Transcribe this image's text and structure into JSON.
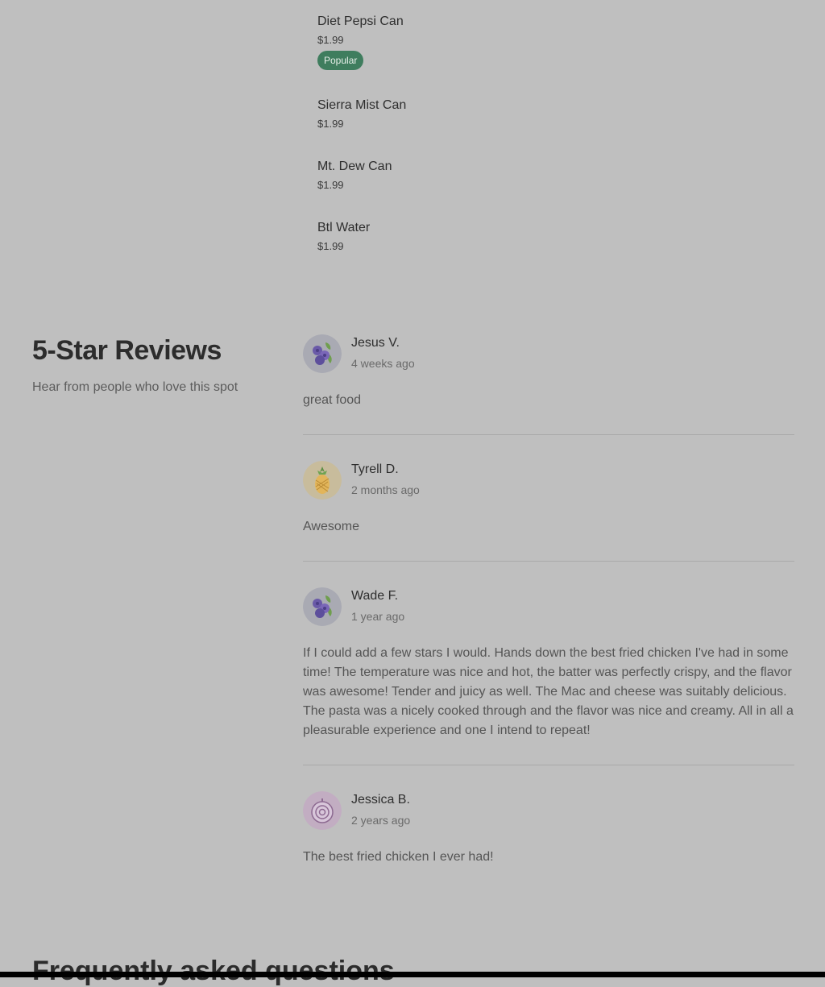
{
  "menu": {
    "items": [
      {
        "name": "Diet Pepsi Can",
        "price": "$1.99",
        "badge": "Popular"
      },
      {
        "name": "Sierra Mist Can",
        "price": "$1.99"
      },
      {
        "name": "Mt. Dew Can",
        "price": "$1.99"
      },
      {
        "name": "Btl Water",
        "price": "$1.99"
      }
    ]
  },
  "reviews": {
    "title": "5-Star Reviews",
    "subtitle": "Hear from people who love this spot",
    "items": [
      {
        "name": "Jesus V.",
        "date": "4 weeks ago",
        "text": "great food",
        "avatar_icon": "blueberry-icon"
      },
      {
        "name": "Tyrell D.",
        "date": "2 months ago",
        "text": "Awesome",
        "avatar_icon": "pineapple-icon"
      },
      {
        "name": "Wade F.",
        "date": "1 year ago",
        "text": "If I could add a few stars I would. Hands down the best fried chicken I've had in some time! The temperature was nice and hot, the batter was perfectly crispy, and the flavor was awesome! Tender and juicy as well. The Mac and cheese was suitably delicious. The pasta was a nicely cooked through and the flavor was nice and creamy. All in all a pleasurable experience and one I intend to repeat!",
        "avatar_icon": "blueberry-icon"
      },
      {
        "name": "Jessica B.",
        "date": "2 years ago",
        "text": "The best fried chicken I ever had!",
        "avatar_icon": "onion-icon"
      }
    ]
  },
  "faq": {
    "title": "Frequently asked questions"
  },
  "colors": {
    "background": "#bfbfbf",
    "badge": "#3f7d5e"
  }
}
